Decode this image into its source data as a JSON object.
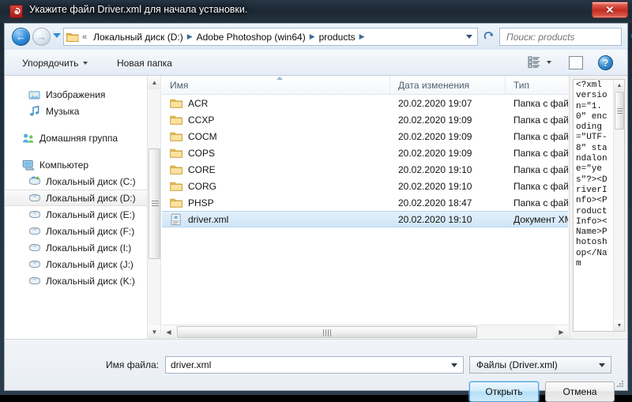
{
  "window": {
    "title": "Укажите файл Driver.xml для начала установки.",
    "app_icon": "app-icon",
    "close_label": "✕"
  },
  "navbar": {
    "back_icon": "←",
    "forward_icon": "→",
    "recent_icon": "chevron-down-icon",
    "address": {
      "chevrons": "«",
      "crumbs": [
        {
          "label": "Локальный диск (D:)",
          "sep": "▶"
        },
        {
          "label": "Adobe Photoshop (win64)",
          "sep": "▶"
        },
        {
          "label": "products",
          "sep": "▶"
        }
      ]
    },
    "refresh_icon": "↻",
    "search": {
      "placeholder": "Поиск: products",
      "value": "",
      "icon": "search-icon"
    }
  },
  "toolbar": {
    "organize_label": "Упорядочить",
    "newfolder_label": "Новая папка",
    "view_icon": "list-view-icon",
    "preview_toggle_icon": "preview-pane-icon",
    "help_label": "?"
  },
  "sidebar": {
    "items": [
      {
        "label": "Изображения",
        "icon": "pictures-icon",
        "indent": true,
        "selected": false
      },
      {
        "label": "Музыка",
        "icon": "music-icon",
        "indent": true,
        "selected": false
      },
      {
        "label": "Домашняя группа",
        "icon": "homegroup-icon",
        "indent": false,
        "selected": false
      },
      {
        "label": "Компьютер",
        "icon": "computer-icon",
        "indent": false,
        "selected": false
      },
      {
        "label": "Локальный диск (C:)",
        "icon": "system-drive-icon",
        "indent": true,
        "selected": false
      },
      {
        "label": "Локальный диск (D:)",
        "icon": "drive-icon",
        "indent": true,
        "selected": true
      },
      {
        "label": "Локальный диск (E:)",
        "icon": "drive-icon",
        "indent": true,
        "selected": false
      },
      {
        "label": "Локальный диск (F:)",
        "icon": "drive-icon",
        "indent": true,
        "selected": false
      },
      {
        "label": "Локальный диск (I:)",
        "icon": "drive-icon",
        "indent": true,
        "selected": false
      },
      {
        "label": "Локальный диск (J:)",
        "icon": "drive-icon",
        "indent": true,
        "selected": false
      },
      {
        "label": "Локальный диск (K:)",
        "icon": "drive-icon",
        "indent": true,
        "selected": false
      }
    ]
  },
  "filelist": {
    "columns": [
      {
        "label": "Имя"
      },
      {
        "label": "Дата изменения"
      },
      {
        "label": "Тип"
      }
    ],
    "sort": "ascending",
    "rows": [
      {
        "name": "ACR",
        "date": "20.02.2020 19:07",
        "type": "Папка с файлами",
        "icon": "folder-icon",
        "selected": false
      },
      {
        "name": "CCXP",
        "date": "20.02.2020 19:09",
        "type": "Папка с файлами",
        "icon": "folder-icon",
        "selected": false
      },
      {
        "name": "COCM",
        "date": "20.02.2020 19:09",
        "type": "Папка с файлами",
        "icon": "folder-icon",
        "selected": false
      },
      {
        "name": "COPS",
        "date": "20.02.2020 19:09",
        "type": "Папка с файлами",
        "icon": "folder-icon",
        "selected": false
      },
      {
        "name": "CORE",
        "date": "20.02.2020 19:10",
        "type": "Папка с файлами",
        "icon": "folder-icon",
        "selected": false
      },
      {
        "name": "CORG",
        "date": "20.02.2020 19:10",
        "type": "Папка с файлами",
        "icon": "folder-icon",
        "selected": false
      },
      {
        "name": "PHSP",
        "date": "20.02.2020 18:47",
        "type": "Папка с файлами",
        "icon": "folder-icon",
        "selected": false
      },
      {
        "name": "driver.xml",
        "date": "20.02.2020 19:10",
        "type": "Документ XML",
        "icon": "xml-file-icon",
        "selected": true
      }
    ]
  },
  "preview": {
    "text": "<?xml version=\"1.0\" encoding=\"UTF-8\" standalone=\"yes\"?><DriverInfo><ProductInfo><Name>Photoshop</Nam"
  },
  "bottom": {
    "filename_label": "Имя файла:",
    "filename_value": "driver.xml",
    "filter_value": "Файлы (Driver.xml)",
    "open_label": "Открыть",
    "cancel_label": "Отмена"
  },
  "colors": {
    "accent": "#2f8ddb",
    "selection": "#cfe5f7",
    "close_red": "#c32c20",
    "title_bar": "#223140"
  }
}
